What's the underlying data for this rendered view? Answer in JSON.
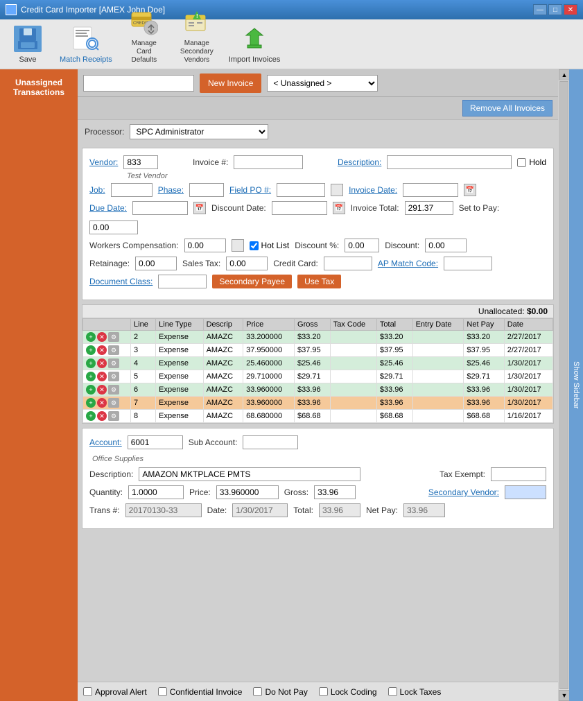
{
  "window": {
    "title": "Credit Card Importer [AMEX John Doe]"
  },
  "toolbar": {
    "items": [
      {
        "id": "save",
        "label": "Save",
        "label_style": "normal"
      },
      {
        "id": "match-receipts",
        "label": "Match Receipts",
        "label_style": "blue"
      },
      {
        "id": "manage-card-defaults",
        "label": "Manage Card Defaults",
        "label_style": "normal"
      },
      {
        "id": "manage-secondary-vendors",
        "label": "Manage Secondary Vendors",
        "label_style": "normal"
      },
      {
        "id": "import-invoices",
        "label": "Import Invoices",
        "label_style": "normal"
      }
    ]
  },
  "nav": {
    "unassigned_transactions": "Unassigned Transactions",
    "new_invoice": "New Invoice",
    "unassigned_option": "< Unassigned >"
  },
  "action_bar": {
    "remove_all": "Remove All Invoices"
  },
  "processor": {
    "label": "Processor:",
    "value": "SPC Administrator"
  },
  "invoice_form": {
    "vendor_label": "Vendor:",
    "vendor_value": "833",
    "vendor_note": "Test Vendor",
    "invoice_num_label": "Invoice #:",
    "invoice_num_value": "",
    "description_label": "Description:",
    "description_value": "",
    "hold_label": "Hold",
    "job_label": "Job:",
    "job_value": "",
    "phase_label": "Phase:",
    "phase_value": "",
    "field_po_label": "Field PO #:",
    "field_po_value": "",
    "invoice_date_label": "Invoice Date:",
    "invoice_date_value": "",
    "due_date_label": "Due Date:",
    "due_date_value": "",
    "discount_date_label": "Discount Date:",
    "discount_date_value": "",
    "invoice_total_label": "Invoice Total:",
    "invoice_total_value": "291.37",
    "set_to_pay_label": "Set to Pay:",
    "set_to_pay_value": "0.00",
    "workers_comp_label": "Workers Compensation:",
    "workers_comp_value": "0.00",
    "hotlist_label": "Hot List",
    "hotlist_checked": true,
    "discount_pct_label": "Discount %:",
    "discount_pct_value": "0.00",
    "discount_label": "Discount:",
    "discount_value": "0.00",
    "retainage_label": "Retainage:",
    "retainage_value": "0.00",
    "sales_tax_label": "Sales Tax:",
    "sales_tax_value": "0.00",
    "credit_card_label": "Credit Card:",
    "credit_card_value": "",
    "ap_match_code_label": "AP Match Code:",
    "ap_match_code_value": "",
    "document_class_label": "Document Class:",
    "document_class_value": "",
    "secondary_payee_btn": "Secondary Payee",
    "use_tax_btn": "Use Tax"
  },
  "unallocated": {
    "label": "Unallocated:",
    "value": "$0.00"
  },
  "table": {
    "headers": [
      "",
      "Line",
      "Line Type",
      "Descrip",
      "Price",
      "Gross",
      "Tax Code",
      "Total",
      "Entry Date",
      "Net Pay",
      "Date"
    ],
    "rows": [
      {
        "line": "2",
        "type": "Expense",
        "descrip": "AMAZC",
        "price": "33.200000",
        "gross": "$33.20",
        "tax_code": "",
        "total": "$33.20",
        "entry_date": "",
        "net_pay": "$33.20",
        "date": "2/27/2017",
        "style": "green"
      },
      {
        "line": "3",
        "type": "Expense",
        "descrip": "AMAZC",
        "price": "37.950000",
        "gross": "$37.95",
        "tax_code": "",
        "total": "$37.95",
        "entry_date": "",
        "net_pay": "$37.95",
        "date": "2/27/2017",
        "style": "white"
      },
      {
        "line": "4",
        "type": "Expense",
        "descrip": "AMAZC",
        "price": "25.460000",
        "gross": "$25.46",
        "tax_code": "",
        "total": "$25.46",
        "entry_date": "",
        "net_pay": "$25.46",
        "date": "1/30/2017",
        "style": "green"
      },
      {
        "line": "5",
        "type": "Expense",
        "descrip": "AMAZC",
        "price": "29.710000",
        "gross": "$29.71",
        "tax_code": "",
        "total": "$29.71",
        "entry_date": "",
        "net_pay": "$29.71",
        "date": "1/30/2017",
        "style": "white"
      },
      {
        "line": "6",
        "type": "Expense",
        "descrip": "AMAZC",
        "price": "33.960000",
        "gross": "$33.96",
        "tax_code": "",
        "total": "$33.96",
        "entry_date": "",
        "net_pay": "$33.96",
        "date": "1/30/2017",
        "style": "green"
      },
      {
        "line": "7",
        "type": "Expense",
        "descrip": "AMAZC",
        "price": "33.960000",
        "gross": "$33.96",
        "tax_code": "",
        "total": "$33.96",
        "entry_date": "",
        "net_pay": "$33.96",
        "date": "1/30/2017",
        "style": "orange"
      },
      {
        "line": "8",
        "type": "Expense",
        "descrip": "AMAZC",
        "price": "68.680000",
        "gross": "$68.68",
        "tax_code": "",
        "total": "$68.68",
        "entry_date": "",
        "net_pay": "$68.68",
        "date": "1/16/2017",
        "style": "white"
      }
    ]
  },
  "detail": {
    "account_label": "Account:",
    "account_value": "6001",
    "account_note": "Office Supplies",
    "sub_account_label": "Sub Account:",
    "sub_account_value": "",
    "description_label": "Description:",
    "description_value": "AMAZON MKTPLACE PMTS",
    "tax_exempt_label": "Tax Exempt:",
    "tax_exempt_value": "",
    "quantity_label": "Quantity:",
    "quantity_value": "1.0000",
    "price_label": "Price:",
    "price_value": "33.960000",
    "gross_label": "Gross:",
    "gross_value": "33.96",
    "secondary_vendor_label": "Secondary Vendor:",
    "secondary_vendor_value": "",
    "trans_label": "Trans #:",
    "trans_value": "20170130-33",
    "date_label": "Date:",
    "date_value": "1/30/2017",
    "total_label": "Total:",
    "total_value": "33.96",
    "net_pay_label": "Net Pay:",
    "net_pay_value": "33.96"
  },
  "footer": {
    "approval_alert": "Approval Alert",
    "confidential_invoice": "Confidential Invoice",
    "do_not_pay": "Do Not Pay",
    "lock_coding": "Lock Coding",
    "lock_taxes": "Lock Taxes"
  },
  "sidebar": {
    "show_sidebar": "Show Sidebar"
  },
  "colors": {
    "orange_btn": "#d4622a",
    "blue_link": "#1a6bb5",
    "green_row": "#d4edda",
    "orange_row": "#f5c99a"
  }
}
